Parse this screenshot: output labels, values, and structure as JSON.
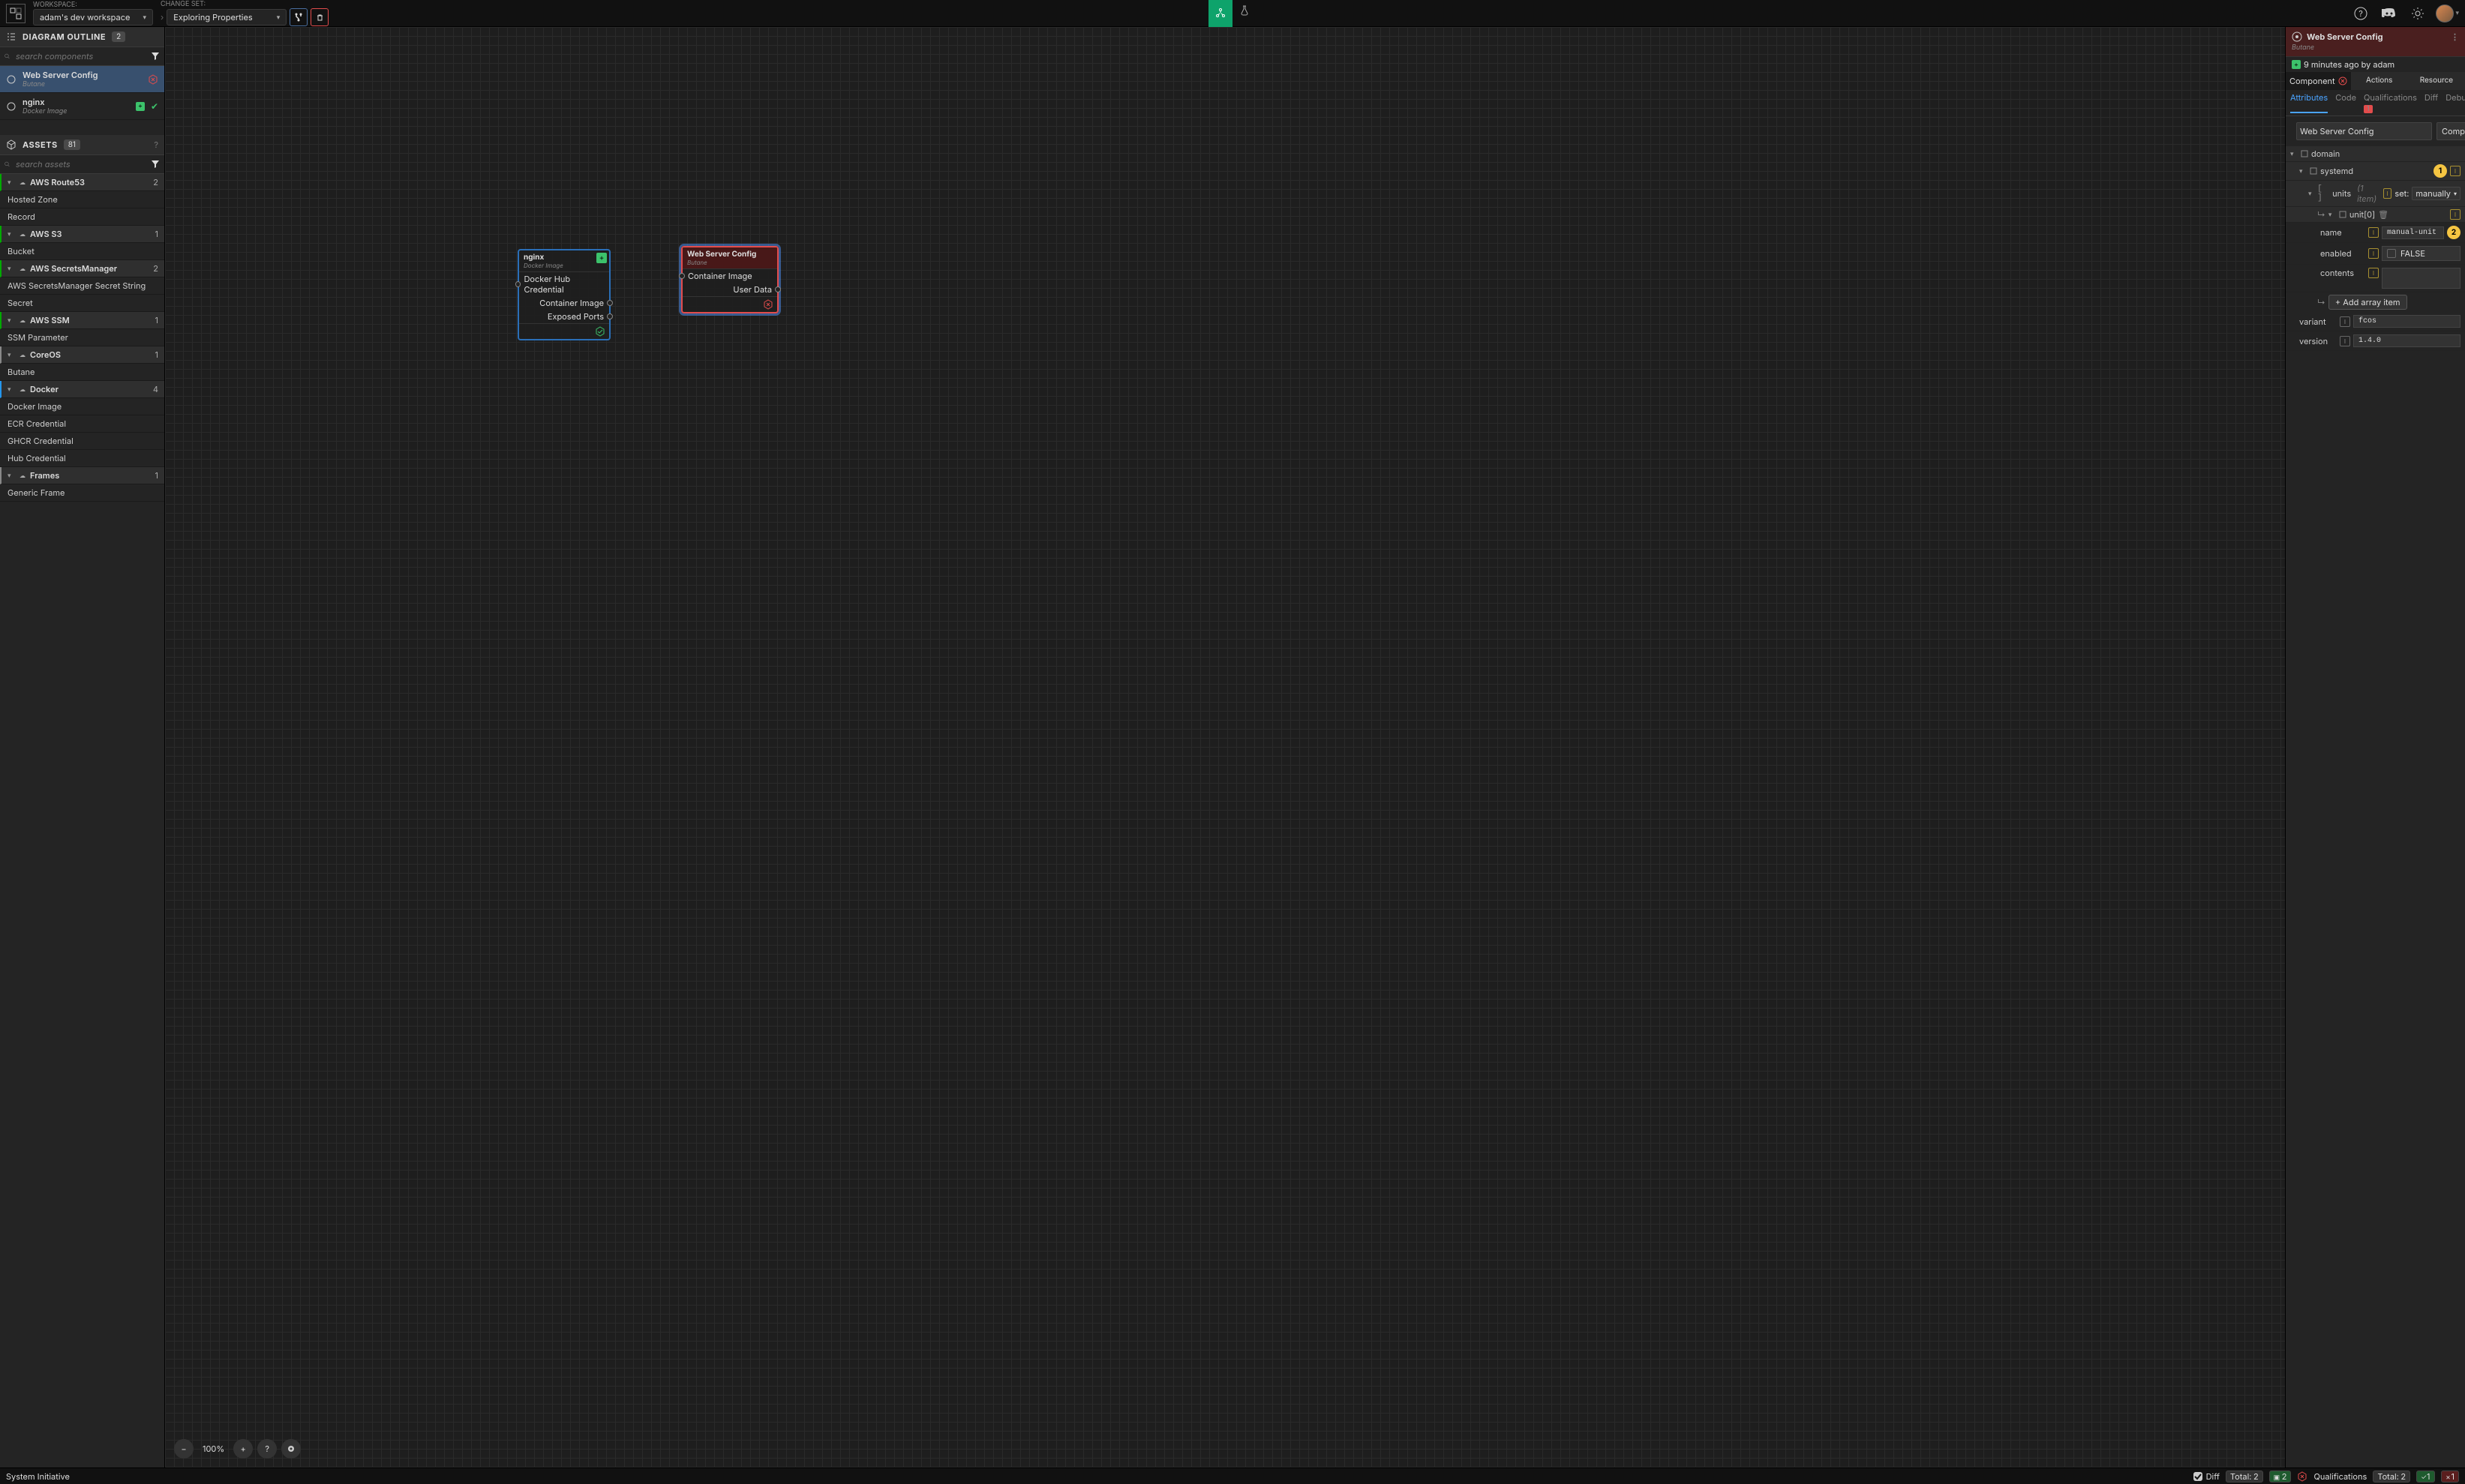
{
  "topbar": {
    "workspace_label": "WORKSPACE:",
    "workspace_value": "adam's dev workspace",
    "changeset_label": "CHANGE SET:",
    "changeset_value": "Exploring Properties"
  },
  "outline": {
    "title": "DIAGRAM OUTLINE",
    "count": "2",
    "search_placeholder": "search components",
    "items": [
      {
        "name": "Web Server Config",
        "sub": "Butane",
        "selected": true,
        "err": true
      },
      {
        "name": "nginx",
        "sub": "Docker Image",
        "plus": true,
        "check": true
      }
    ]
  },
  "assets": {
    "title": "ASSETS",
    "count": "81",
    "search_placeholder": "search assets",
    "groups": [
      {
        "name": "AWS Route53",
        "count": "2",
        "cls": "",
        "children": [
          "Hosted Zone",
          "Record"
        ]
      },
      {
        "name": "AWS S3",
        "count": "1",
        "cls": "",
        "children": [
          "Bucket"
        ]
      },
      {
        "name": "AWS SecretsManager",
        "count": "2",
        "cls": "",
        "children": [
          "AWS SecretsManager Secret String",
          "Secret"
        ]
      },
      {
        "name": "AWS SSM",
        "count": "1",
        "cls": "",
        "children": [
          "SSM Parameter"
        ]
      },
      {
        "name": "CoreOS",
        "count": "1",
        "cls": "coreos",
        "children": [
          "Butane"
        ]
      },
      {
        "name": "Docker",
        "count": "4",
        "cls": "docker",
        "children": [
          "Docker Image",
          "ECR Credential",
          "GHCR Credential",
          "Hub Credential"
        ]
      },
      {
        "name": "Frames",
        "count": "1",
        "cls": "frames",
        "children": [
          "Generic Frame"
        ]
      }
    ]
  },
  "canvas": {
    "zoom": "100%",
    "nodes": {
      "nginx": {
        "title": "nginx",
        "sub": "Docker Image",
        "ports_in": [
          "Docker Hub Credential"
        ],
        "ports_out": [
          "Container Image",
          "Exposed Ports"
        ]
      },
      "wsc": {
        "title": "Web Server Config",
        "sub": "Butane",
        "ports_in": [
          "Container Image"
        ],
        "ports_out": [
          "User Data"
        ]
      }
    }
  },
  "inspector": {
    "title": "Web Server Config",
    "sub": "Butane",
    "meta": "9 minutes ago by adam",
    "tabs": [
      "Component",
      "Actions",
      "Resource"
    ],
    "subtabs": {
      "items": [
        "Attributes",
        "Code",
        "Qualifications",
        "Diff",
        "Debug"
      ],
      "q_badge": "1"
    },
    "name_value": "Web Server Config",
    "type_value": "Compon...",
    "callout1": "1",
    "callout2": "2",
    "units_count": "(1 item)",
    "set_label": "set:",
    "set_value": "manually",
    "unit0": "unit[0]",
    "add_item": "+  Add array item",
    "fields": {
      "name_lbl": "name",
      "name_val": "manual-unit",
      "enabled_lbl": "enabled",
      "enabled_val": "FALSE",
      "contents_lbl": "contents",
      "variant_lbl": "variant",
      "variant_val": "fcos",
      "version_lbl": "version",
      "version_val": "1.4.0"
    },
    "tree": {
      "domain": "domain",
      "systemd": "systemd",
      "units": "units"
    }
  },
  "statusbar": {
    "brand": "System Initiative",
    "diff": "Diff",
    "diff_total": "Total:",
    "diff_n": "2",
    "diff_g": "2",
    "qual": "Qualifications",
    "q_total": "Total:",
    "q_n": "2",
    "q_g": "1",
    "q_r": "1"
  }
}
